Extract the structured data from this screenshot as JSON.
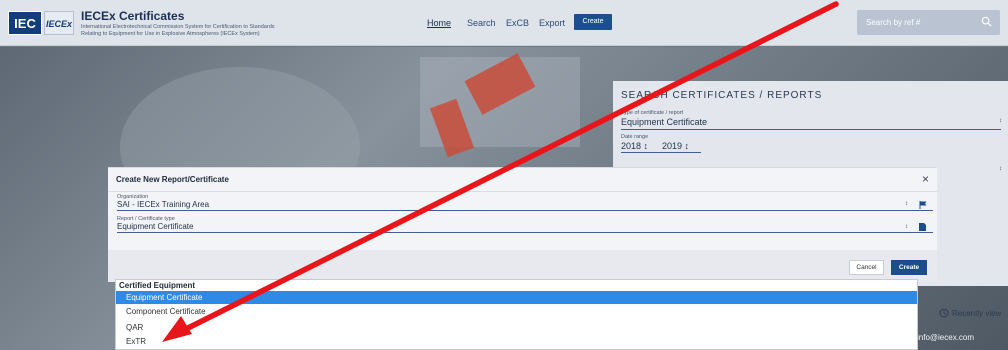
{
  "header": {
    "logo_iec": "IEC",
    "logo_iecex": "IECEx",
    "title": "IECEx Certificates",
    "subtitle_line1": "International Electrotechnical Commission System for Certification to Standards",
    "subtitle_line2": "Relating to Equipment for Use in Explosive Atmospheres (IECEx System)",
    "nav": [
      "Home",
      "Search",
      "ExCB",
      "Export"
    ],
    "create_label": "Create",
    "search_placeholder": "Search by ref #"
  },
  "search_panel": {
    "title": "SEARCH CERTIFICATES / REPORTS",
    "type_label": "Type of certificate / report",
    "type_value": "Equipment Certificate",
    "date_label": "Date range",
    "date_from": "2018 ↕",
    "date_to": "2019 ↕"
  },
  "recently_viewed": "Recently view",
  "contact_email": "info@iecex.com",
  "modal": {
    "title": "Create New Report/Certificate",
    "close": "×",
    "org_label": "Organization",
    "org_value": "SAI - IECEx Training Area",
    "type_label": "Report / Certificate type",
    "type_value": "Equipment Certificate",
    "cancel_label": "Cancel",
    "create_label": "Create"
  },
  "dropdown": {
    "group_label": "Certified Equipment",
    "options": [
      "Equipment Certificate",
      "Component Certificate",
      "QAR",
      "ExTR"
    ],
    "selected": "Equipment Certificate"
  },
  "colors": {
    "annotation_arrow": "#e8161b",
    "selected_option": "#2f8ae6",
    "primary_button": "#1b4d8c"
  }
}
